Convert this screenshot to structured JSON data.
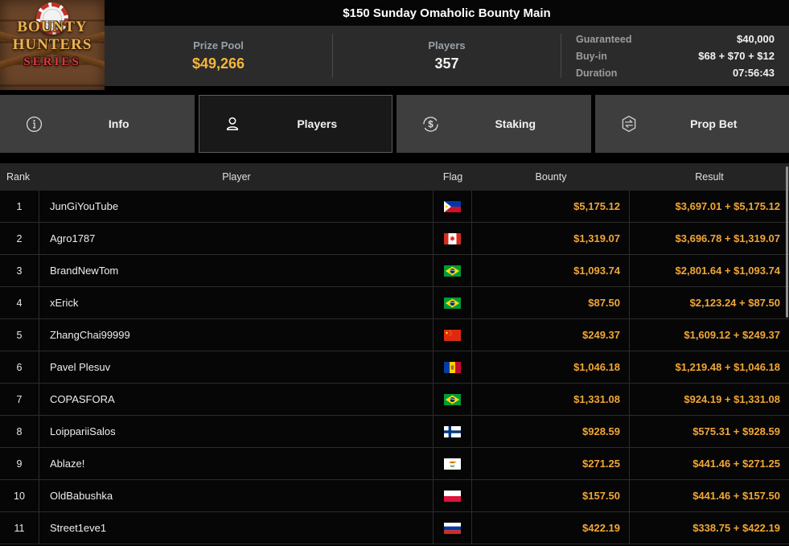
{
  "title": "$150 Sunday Omaholic Bounty Main",
  "logo": {
    "line1": "BOUNTY",
    "line2": "HUNTERS",
    "line3": "SERIES"
  },
  "stats": {
    "prize_pool_label": "Prize Pool",
    "prize_pool_value": "$49,266",
    "players_label": "Players",
    "players_value": "357",
    "details": [
      {
        "label": "Guaranteed",
        "value": "$40,000"
      },
      {
        "label": "Buy-in",
        "value": "$68 + $70 + $12"
      },
      {
        "label": "Duration",
        "value": "07:56:43"
      }
    ]
  },
  "tabs": [
    {
      "id": "info",
      "label": "Info",
      "icon": "info-icon",
      "active": false
    },
    {
      "id": "players",
      "label": "Players",
      "icon": "person-icon",
      "active": true
    },
    {
      "id": "staking",
      "label": "Staking",
      "icon": "dollar-circle-icon",
      "active": false
    },
    {
      "id": "propbet",
      "label": "Prop Bet",
      "icon": "hexagon-swap-icon",
      "active": false
    }
  ],
  "table": {
    "columns": [
      "Rank",
      "Player",
      "Flag",
      "Bounty",
      "Result"
    ],
    "rows": [
      {
        "rank": "1",
        "player": "JunGiYouTube",
        "flag": "ph",
        "bounty": "$5,175.12",
        "result": "$3,697.01 + $5,175.12"
      },
      {
        "rank": "2",
        "player": "Agro1787",
        "flag": "ca",
        "bounty": "$1,319.07",
        "result": "$3,696.78 + $1,319.07"
      },
      {
        "rank": "3",
        "player": "BrandNewTom",
        "flag": "br",
        "bounty": "$1,093.74",
        "result": "$2,801.64 + $1,093.74"
      },
      {
        "rank": "4",
        "player": "xErick",
        "flag": "br",
        "bounty": "$87.50",
        "result": "$2,123.24 + $87.50"
      },
      {
        "rank": "5",
        "player": "ZhangChai99999",
        "flag": "cn",
        "bounty": "$249.37",
        "result": "$1,609.12 + $249.37"
      },
      {
        "rank": "6",
        "player": "Pavel Plesuv",
        "flag": "md",
        "bounty": "$1,046.18",
        "result": "$1,219.48 + $1,046.18"
      },
      {
        "rank": "7",
        "player": "COPASFORA",
        "flag": "br",
        "bounty": "$1,331.08",
        "result": "$924.19 + $1,331.08"
      },
      {
        "rank": "8",
        "player": "LoippariiSalos",
        "flag": "fi",
        "bounty": "$928.59",
        "result": "$575.31 + $928.59"
      },
      {
        "rank": "9",
        "player": "Ablaze!",
        "flag": "cy",
        "bounty": "$271.25",
        "result": "$441.46 + $271.25"
      },
      {
        "rank": "10",
        "player": "OldBabushka",
        "flag": "pl",
        "bounty": "$157.50",
        "result": "$441.46 + $157.50"
      },
      {
        "rank": "11",
        "player": "Street1eve1",
        "flag": "ru",
        "bounty": "$422.19",
        "result": "$338.75 + $422.19"
      }
    ]
  },
  "colors": {
    "accent_gold": "#f2a636",
    "prize_gold": "#f5b63c",
    "series_red": "#d8393f"
  }
}
